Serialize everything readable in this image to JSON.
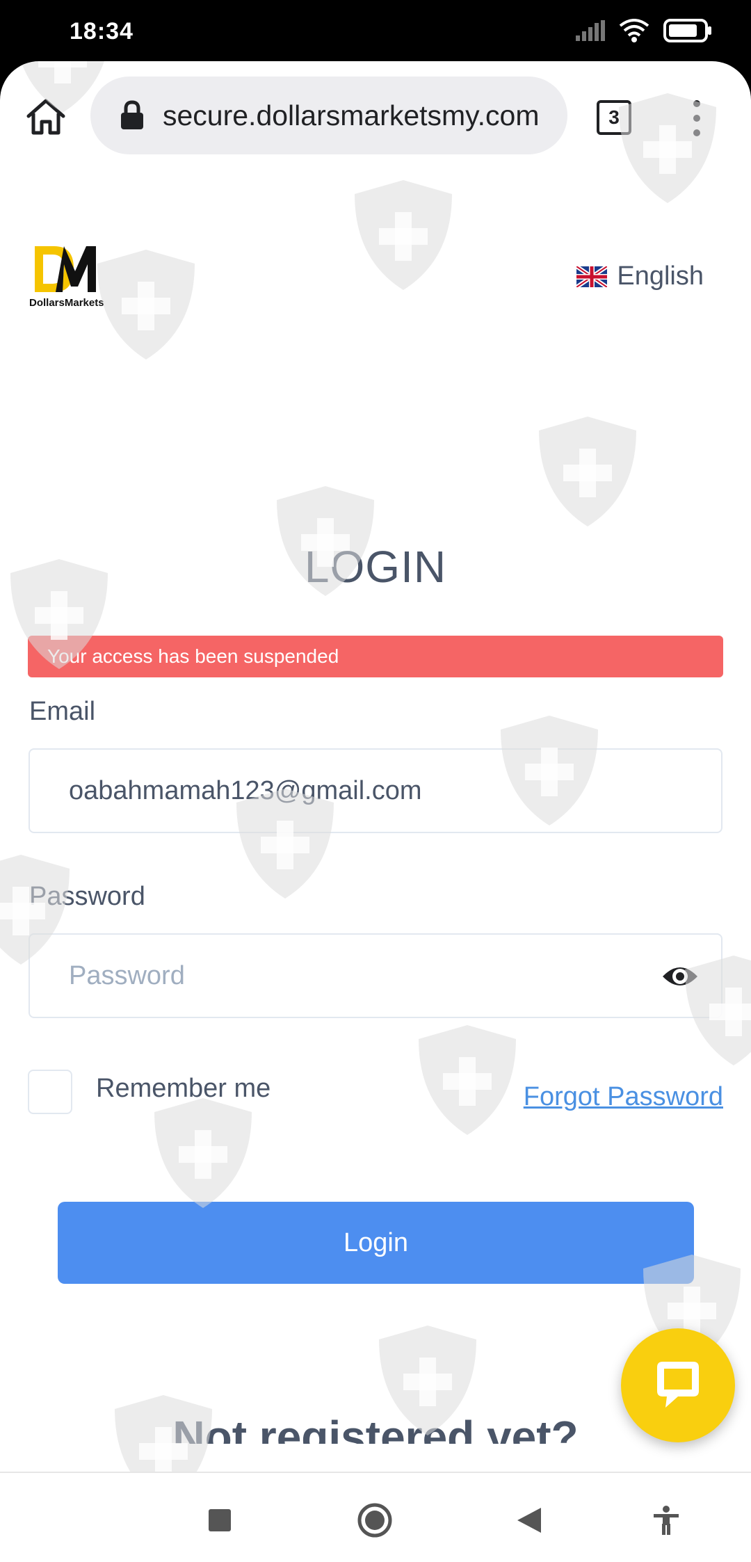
{
  "status_bar": {
    "time": "18:34",
    "icons": [
      "signal-icon",
      "wifi-icon",
      "battery-icon"
    ]
  },
  "browser": {
    "url": "secure.dollarsmarketsmy.com",
    "tab_count": "3",
    "icons": [
      "home-icon",
      "lock-icon",
      "menu-dots-icon"
    ]
  },
  "site": {
    "logo_text": "DollarsMarkets",
    "language": {
      "label": "English",
      "flag": "uk-flag-icon"
    }
  },
  "login": {
    "title": "LOGIN",
    "alert": "Your access has been suspended",
    "email_label": "Email",
    "email_value": "oabahmamah123@gmail.com",
    "password_label": "Password",
    "password_placeholder": "Password",
    "remember_label": "Remember me",
    "remember_checked": false,
    "forgot_label": "Forgot Password",
    "submit_label": "Login",
    "register_heading_partial": "Not registered yet?"
  },
  "chat": {
    "icon": "chat-bubble-icon"
  },
  "nav_bar": {
    "icons": [
      "recents-icon",
      "home-circle-icon",
      "back-icon",
      "accessibility-icon"
    ]
  },
  "colors": {
    "alert_bg": "#f56565",
    "button_bg": "#4d8ef0",
    "link": "#4a90e2",
    "text": "#4a5568",
    "chat_bg": "#f9cf0f",
    "logo_yellow": "#f5c400"
  }
}
